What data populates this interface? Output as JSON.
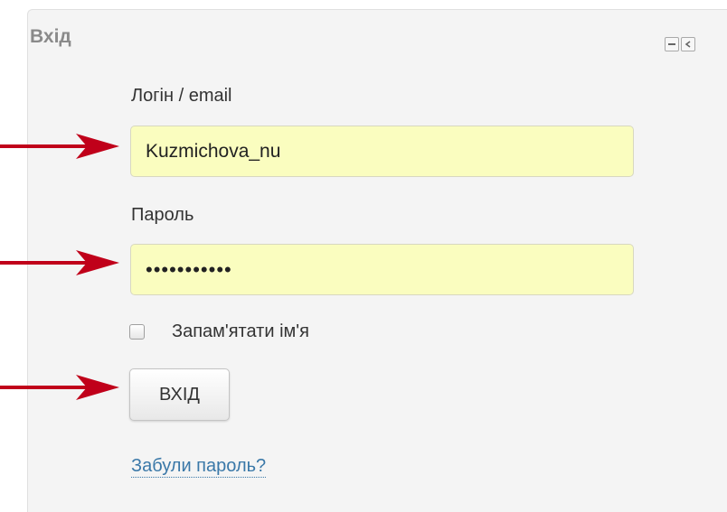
{
  "block": {
    "title": "Вхід"
  },
  "form": {
    "username_label": "Логін / email",
    "username_value": "Kuzmichova_nu",
    "password_label": "Пароль",
    "password_value": "1234567890a",
    "remember_label": "Запам'ятати ім'я",
    "remember_checked": false,
    "submit_label": "ВХІД",
    "forgot_link": "Забули пароль?"
  },
  "icons": {
    "minimize": "minimize-icon",
    "dock": "dock-left-icon",
    "arrow": "arrow-right-icon"
  },
  "colors": {
    "input_background": "#fafdbf",
    "annotation_arrow": "#c0001a",
    "link": "#3a78a8",
    "block_background": "#f4f4f4"
  }
}
